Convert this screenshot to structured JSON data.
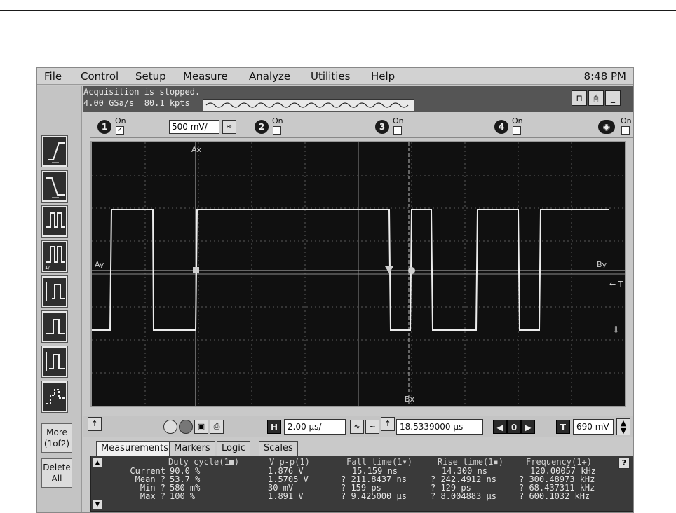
{
  "menu": {
    "file": "File",
    "control": "Control",
    "setup": "Setup",
    "measure": "Measure",
    "analyze": "Analyze",
    "utilities": "Utilities",
    "help": "Help"
  },
  "clock": "8:48 PM",
  "status": {
    "line1": "Acquisition is stopped.",
    "line2": "4.00 GSa/s  80.1 kpts"
  },
  "channels": {
    "ch1": {
      "num": "1",
      "state": "On",
      "scale": "500 mV/"
    },
    "ch2": {
      "num": "2",
      "state": "On"
    },
    "ch3": {
      "num": "3",
      "state": "On"
    },
    "ch4": {
      "num": "4",
      "state": "On"
    },
    "math": {
      "state": "On"
    }
  },
  "screen_labels": {
    "ax": "Ax",
    "ay": "Ay",
    "bx": "Bx",
    "by": "By",
    "trig": "← T"
  },
  "side": {
    "more": "More",
    "more_pages": "(1of2)",
    "delete": "Delete",
    "delete_all": "All"
  },
  "controls": {
    "h_btn": "H",
    "timebase": "2.00 µs/",
    "delay": "18.5339000 µs",
    "t_btn": "T",
    "trig_level": "690 mV"
  },
  "tabs": [
    "Measurements",
    "Markers",
    "Logic",
    "Scales"
  ],
  "measurements": {
    "row_labels": [
      "",
      "Current",
      "Mean ?",
      "Min ?",
      "Max ?"
    ],
    "columns": [
      {
        "header": "Duty cycle(1■)",
        "values": [
          "90.0 %",
          "53.7 %",
          "580 m%",
          "100 %"
        ]
      },
      {
        "header": "V p-p(1)",
        "values": [
          "1.876 V",
          "1.5705 V",
          "30 mV",
          "1.891 V"
        ]
      },
      {
        "header": "Fall time(1▾)",
        "values": [
          "15.159 ns",
          "? 211.8437 ns",
          "? 159 ps",
          "? 9.425000 µs"
        ]
      },
      {
        "header": "Rise time(1▪)",
        "values": [
          "14.300 ns",
          "? 242.4912 ns",
          "? 129 ps",
          "? 8.004883 µs"
        ]
      },
      {
        "header": "Frequency(1+)",
        "values": [
          "120.00057 kHz",
          "? 300.48973 kHz",
          "? 68.437311 kHz",
          "? 600.1032 kHz"
        ]
      }
    ]
  },
  "colors": {
    "screen_bg": "#101010",
    "trace": "#e8e8e8",
    "grid": "#6a6a6a"
  },
  "icons": [
    "rising-edge-icon",
    "falling-edge-icon",
    "pulse-width-icon",
    "glitch-icon",
    "runt-icon",
    "timeout-icon",
    "transition-icon",
    "setup-hold-icon",
    "help-icon"
  ]
}
